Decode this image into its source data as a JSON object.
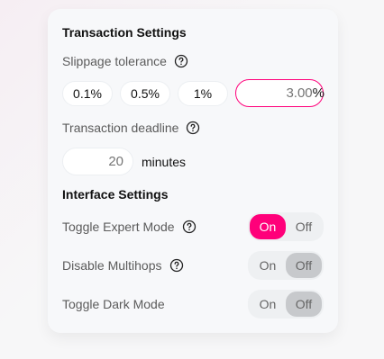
{
  "transaction": {
    "title": "Transaction Settings",
    "slippage_label": "Slippage tolerance",
    "slippage_presets": [
      "0.1%",
      "0.5%",
      "1%"
    ],
    "custom_slippage_value": "3.00",
    "custom_slippage_suffix": "%",
    "deadline_label": "Transaction deadline",
    "deadline_value": "20",
    "deadline_unit": "minutes"
  },
  "interface": {
    "title": "Interface Settings",
    "toggles": [
      {
        "label": "Toggle Expert Mode",
        "on_label": "On",
        "off_label": "Off",
        "selected": "On"
      },
      {
        "label": "Disable Multihops",
        "on_label": "On",
        "off_label": "Off",
        "selected": "Off"
      },
      {
        "label": "Toggle Dark Mode",
        "on_label": "On",
        "off_label": "Off",
        "selected": "Off"
      }
    ]
  },
  "colors": {
    "accent": "#ff007a",
    "toggle_off_active": "#c7c9cc"
  },
  "icons": {
    "help": "question-circle-icon"
  }
}
